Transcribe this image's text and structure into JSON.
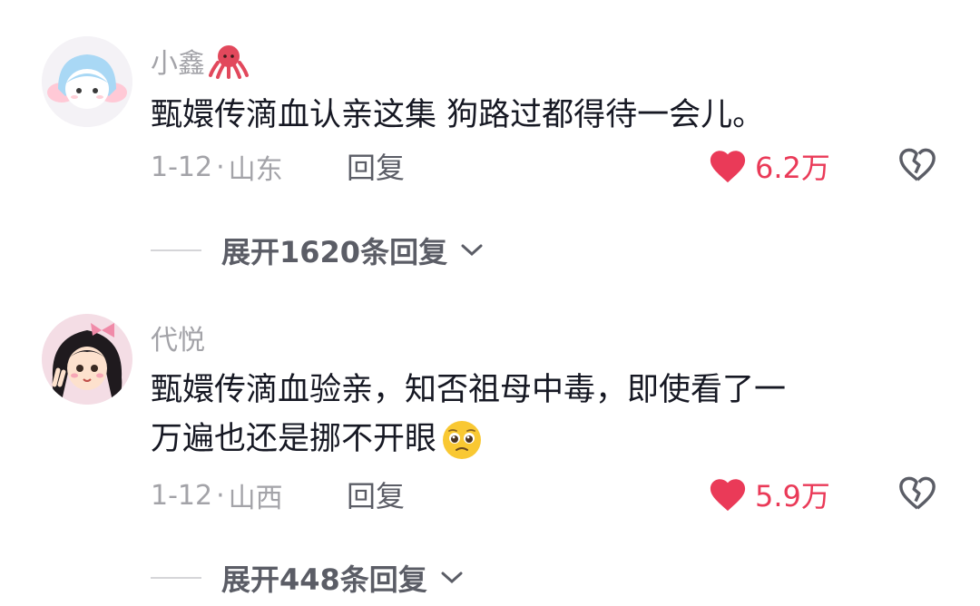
{
  "comments": [
    {
      "username": "小鑫",
      "username_emoji": "octopus-emoji",
      "text_lines": [
        "甄嬛传滴血认亲这集 狗路过都得待一会儿。"
      ],
      "date": "1-12",
      "location": "山东",
      "reply_label": "回复",
      "likes": "6.2万",
      "expand_label": "展开1620条回复",
      "avatar": "cartoon-girl-light-blue-hair"
    },
    {
      "username": "代悦",
      "text_lines": [
        "甄嬛传滴血验亲，知否祖母中毒，即使看了一",
        "万遍也还是挪不开眼"
      ],
      "text_emoji": "pleading-face-emoji",
      "date": "1-12",
      "location": "山西",
      "reply_label": "回复",
      "likes": "5.9万",
      "expand_label": "展开448条回复",
      "avatar": "cartoon-girl-black-hair-pink-bow"
    }
  ],
  "colors": {
    "text": "#161823",
    "secondary": "#a3a3a8",
    "like": "#ea3a58",
    "reply": "#5b5d66"
  }
}
